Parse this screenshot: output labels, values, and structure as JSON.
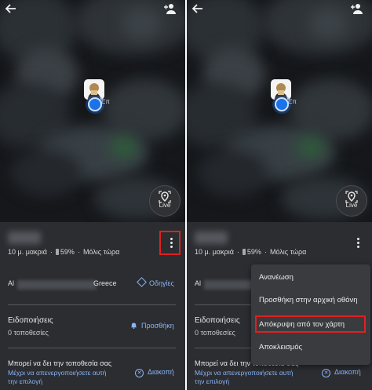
{
  "left": {
    "status": {
      "distance": "10 μ. μακριά",
      "battery": "59%",
      "time": "Μόλις τώρα"
    },
    "map": {
      "live_label": "Live",
      "marker_label": "Επ"
    },
    "address": {
      "prefix": "Al",
      "suffix": "Greece",
      "directions_label": "Οδηγίες"
    },
    "notifications": {
      "title": "Ειδοποιήσεις",
      "count": "0 τοποθεσίες",
      "add_label": "Προσθήκη"
    },
    "sharing": {
      "title": "Μπορεί να δει την τοποθεσία σας",
      "until_line1": "Μέχρι να απενεργοποιήσετε αυτή",
      "until_line2": "την επιλογή",
      "stop_label": "Διακοπή"
    }
  },
  "right": {
    "status": {
      "distance": "10 μ. μακριά",
      "battery": "59%",
      "time": "Μόλις τώρα"
    },
    "map": {
      "live_label": "Live",
      "marker_label": "Επ"
    },
    "address": {
      "prefix": "Al"
    },
    "notifications": {
      "title": "Ειδοποιήσεις",
      "count": "0 τοποθεσίες"
    },
    "sharing": {
      "title": "Μπορεί να δει την τοποθεσία σας",
      "until_line1": "Μέχρι να απενεργοποιήσετε αυτή",
      "until_line2": "την επιλογή",
      "stop_label": "Διακοπή"
    },
    "menu": {
      "items": [
        "Ανανέωση",
        "Προσθήκη στην αρχική οθόνη",
        "Απόκρυψη από τον χάρτη",
        "Αποκλεισμός"
      ]
    }
  },
  "colors": {
    "accent": "#8ab4f8",
    "highlight": "#e02020",
    "background": "#2b2d31",
    "location_dot": "#1a73e8"
  },
  "icons": [
    "arrow-back-icon",
    "person-add-icon",
    "live-location-icon",
    "more-vert-icon",
    "directions-icon",
    "bell-icon",
    "cancel-icon"
  ]
}
